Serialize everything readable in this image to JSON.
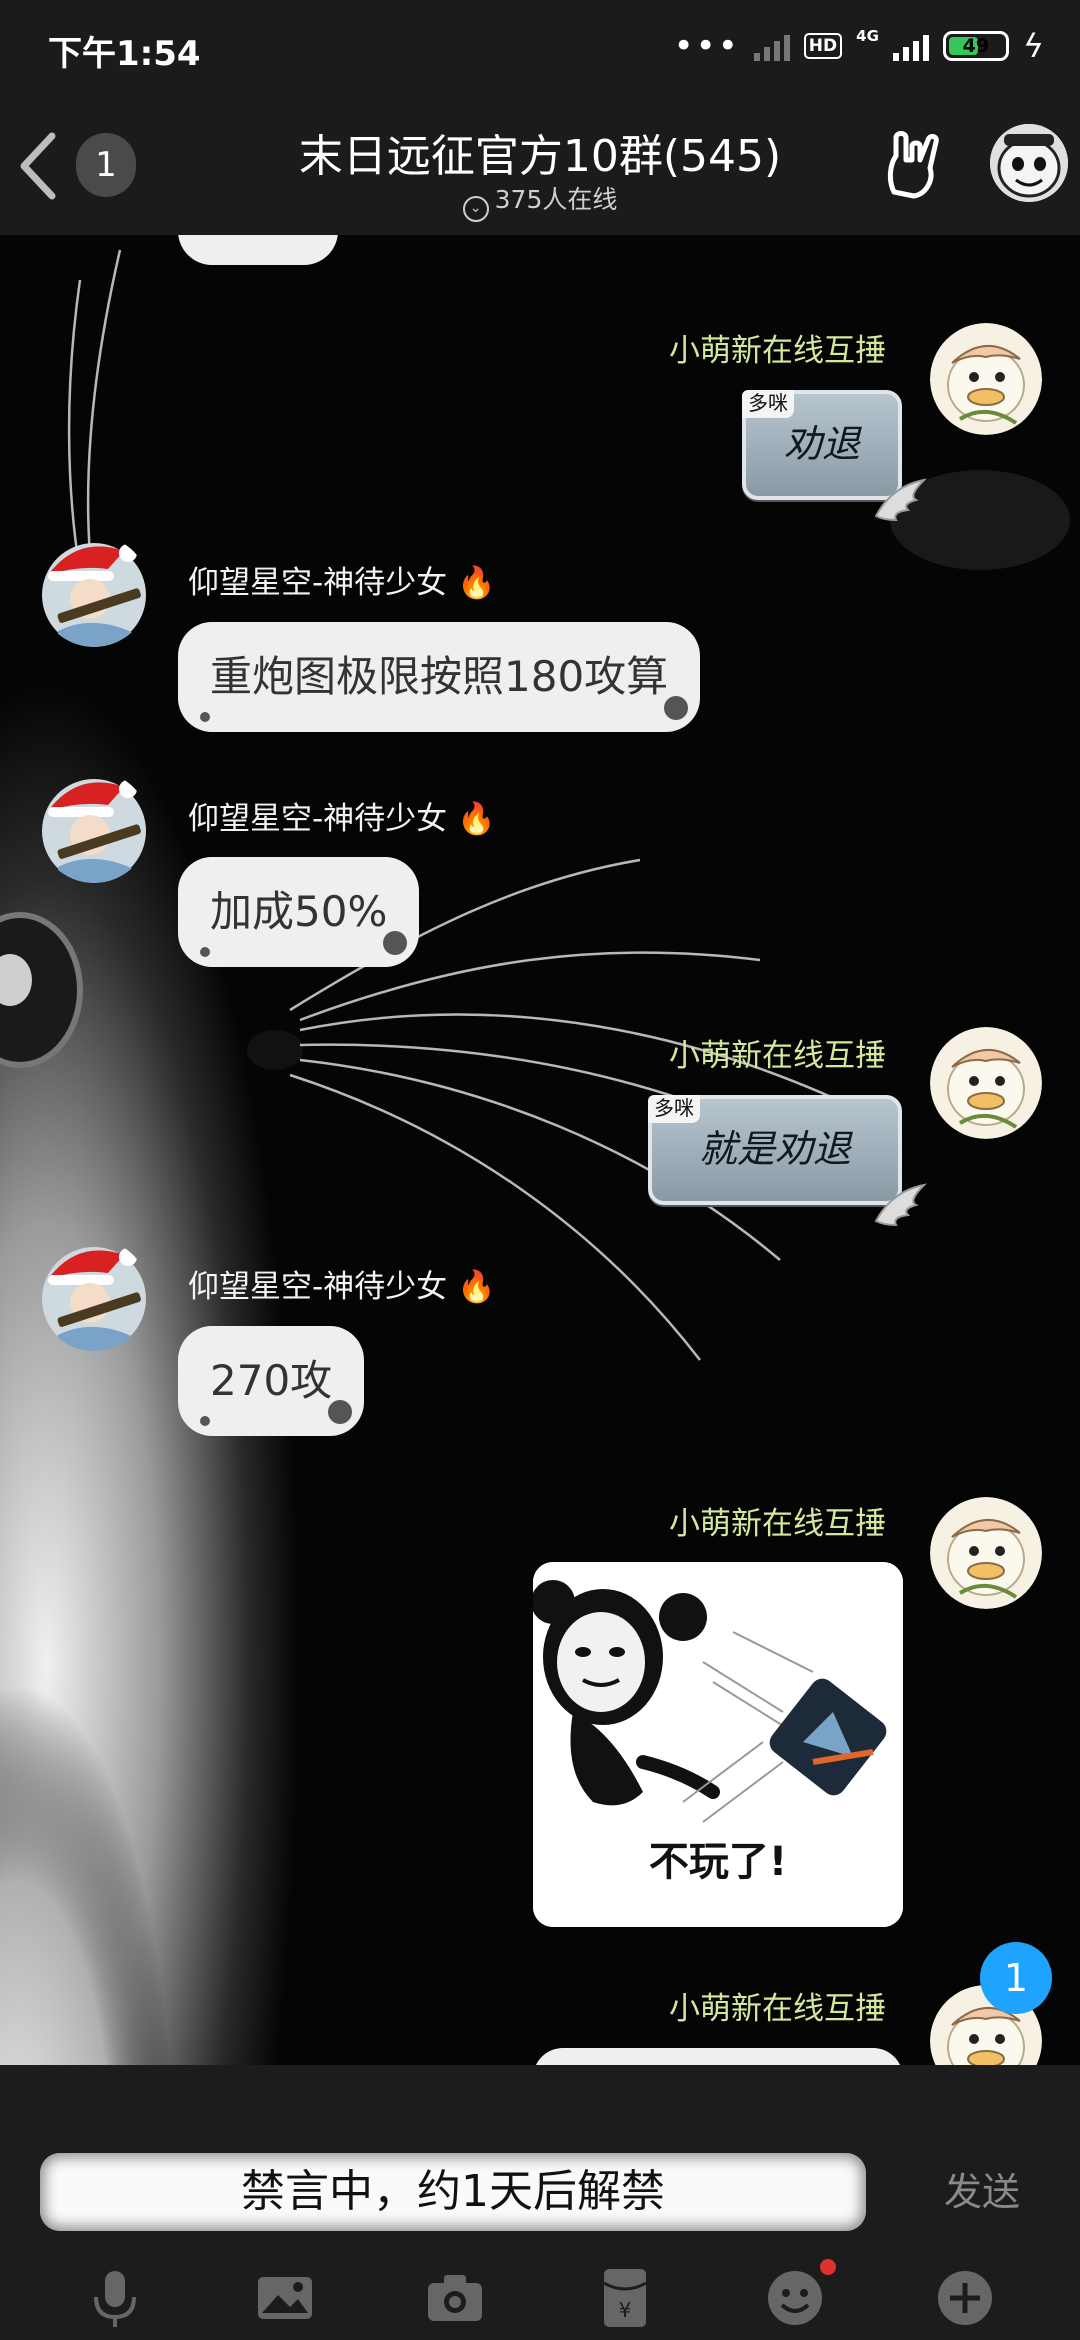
{
  "status_bar": {
    "time": "下午1:54",
    "hd_label": "HD",
    "network_label": "4G",
    "battery": "49"
  },
  "header": {
    "unread_count": "1",
    "title": "末日远征官方10群(545)",
    "online_text": "375人在线"
  },
  "messages": [
    {
      "sender": "小萌新在线互捶",
      "side": "right",
      "type": "sticker",
      "tag": "多咪",
      "text": "劝退"
    },
    {
      "sender": "仰望星空-神待少女",
      "side": "left",
      "type": "text",
      "text": "重炮图极限按照180攻算"
    },
    {
      "sender": "仰望星空-神待少女",
      "side": "left",
      "type": "text",
      "text": "加成50%"
    },
    {
      "sender": "小萌新在线互捶",
      "side": "right",
      "type": "sticker",
      "tag": "多咪",
      "text": "就是劝退"
    },
    {
      "sender": "仰望星空-神待少女",
      "side": "left",
      "type": "text",
      "text": "270攻"
    },
    {
      "sender": "小萌新在线互捶",
      "side": "right",
      "type": "image",
      "caption": "不玩了!"
    },
    {
      "sender": "小萌新在线互捶",
      "side": "right",
      "type": "partial"
    }
  ],
  "fire_emoji": "🔥",
  "new_message_badge": "1",
  "input": {
    "mute_text": "禁言中，约1天后解禁",
    "send_label": "发送"
  },
  "toolbar_icons": [
    "microphone-icon",
    "image-icon",
    "camera-icon",
    "red-packet-icon",
    "emoji-icon",
    "plus-icon"
  ]
}
